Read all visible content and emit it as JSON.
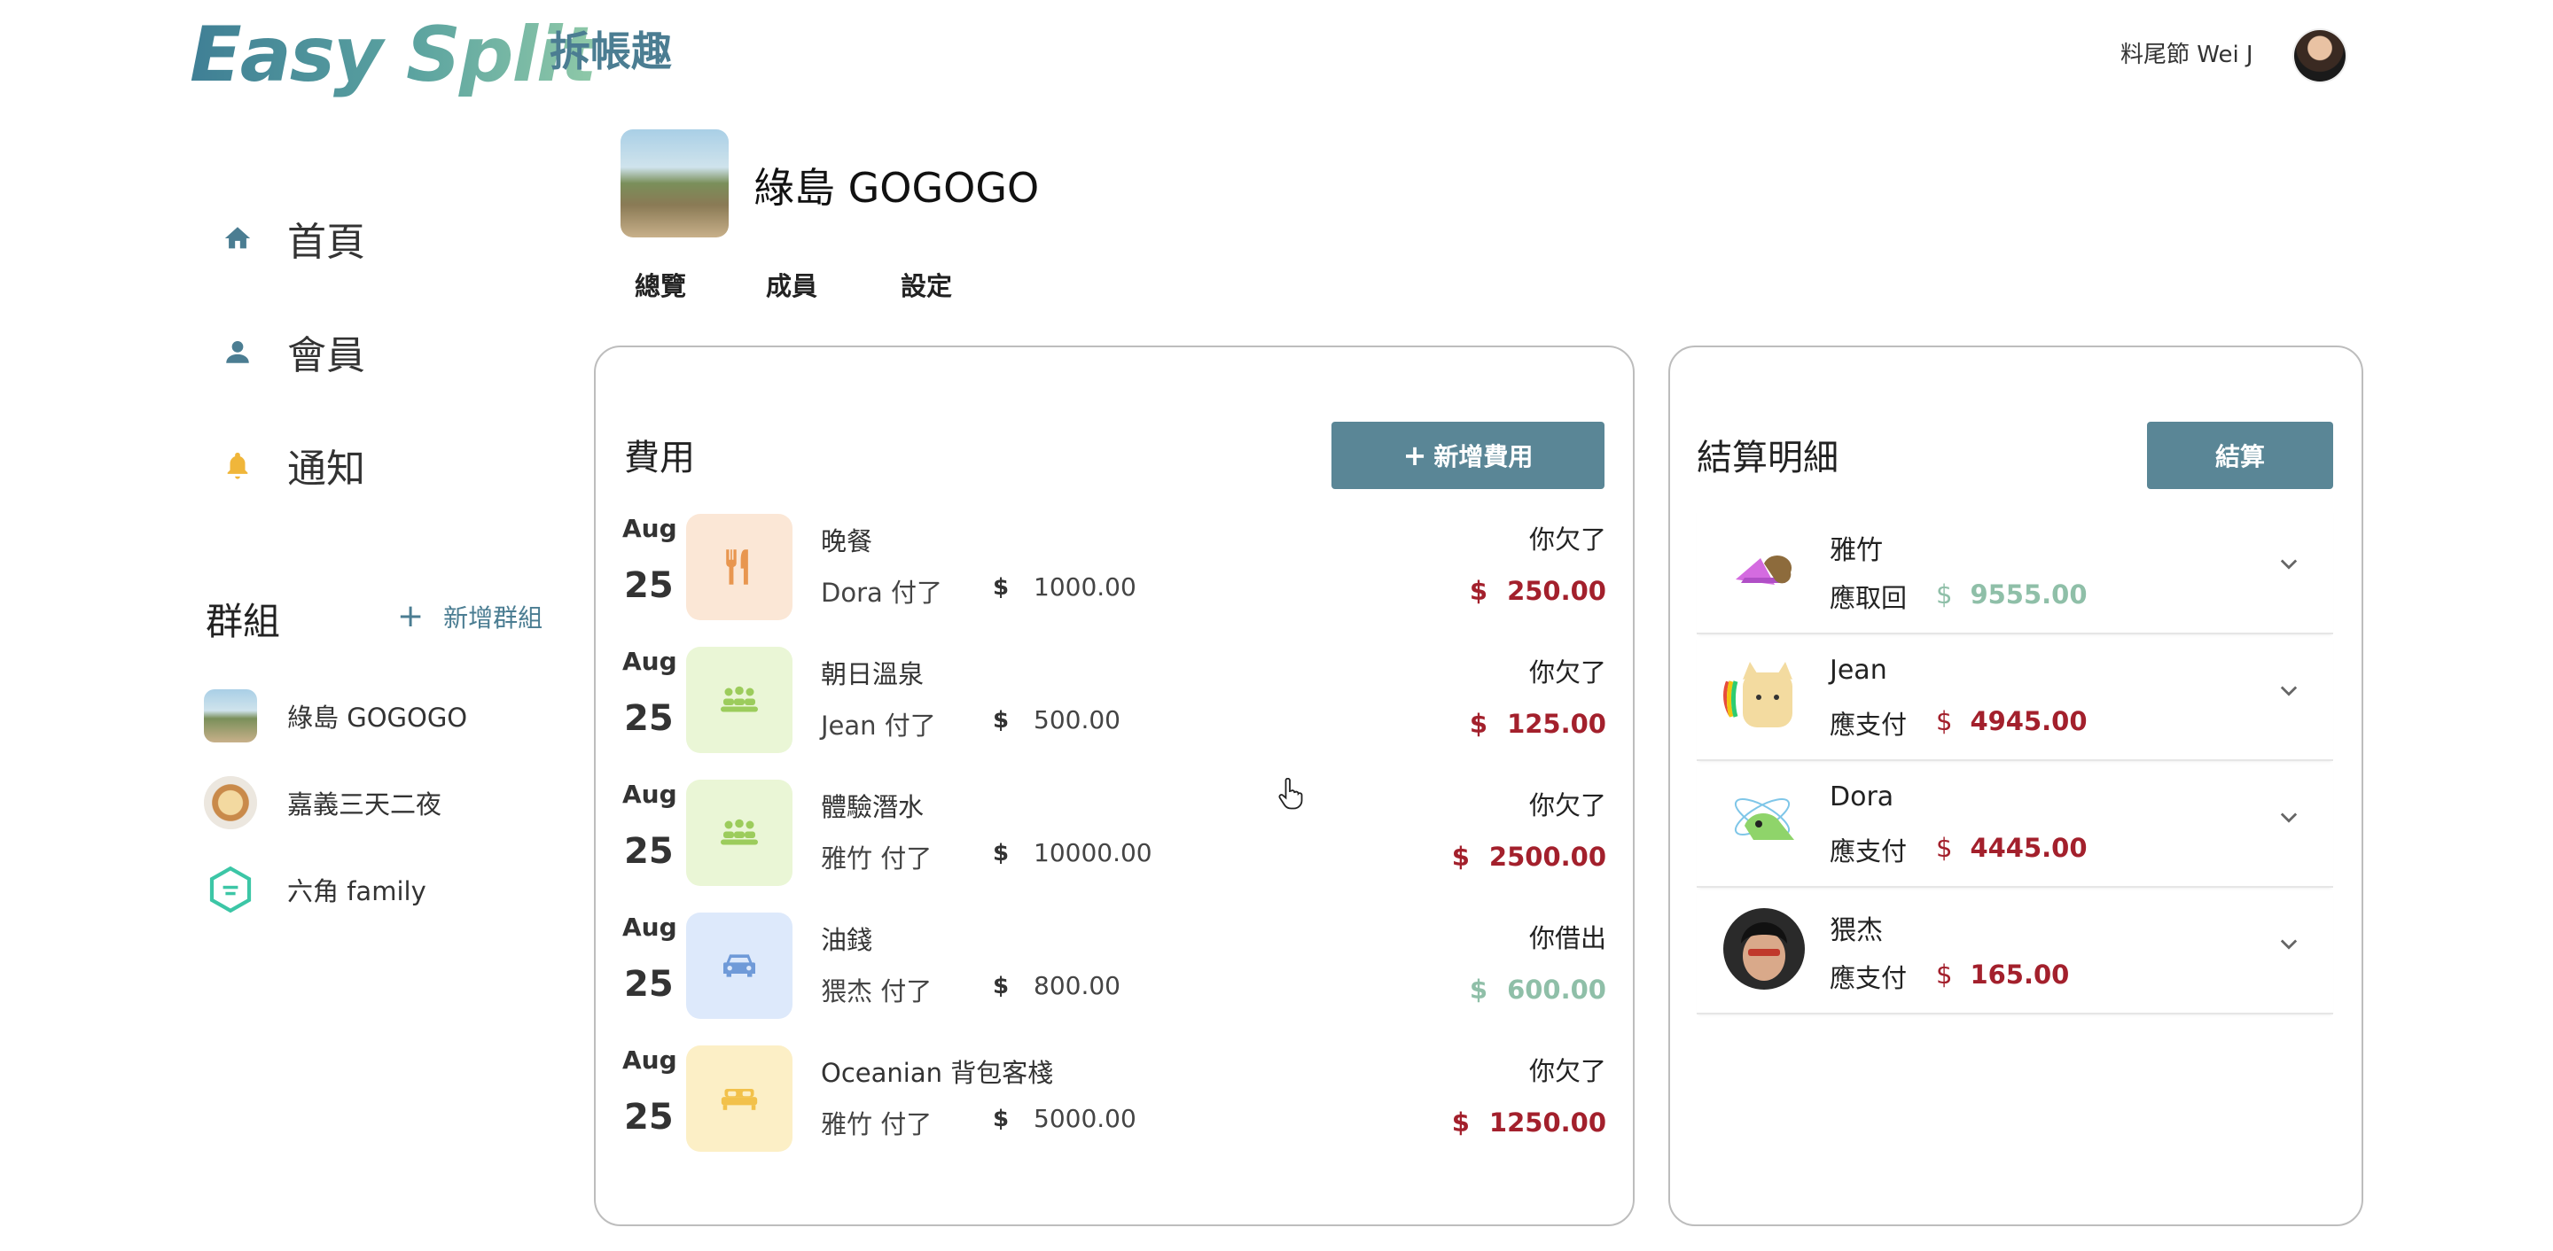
{
  "header": {
    "logo": "Easy Split",
    "logo_sub": "拆帳趣",
    "user_name": "料尾節 Wei J"
  },
  "sidebar": {
    "nav": [
      {
        "label": "首頁",
        "icon": "home-icon"
      },
      {
        "label": "會員",
        "icon": "person-icon"
      },
      {
        "label": "通知",
        "icon": "bell-icon"
      }
    ],
    "groups_title": "群組",
    "add_group": "新增群組",
    "groups": [
      {
        "name": "綠島 GOGOGO"
      },
      {
        "name": "嘉義三天二夜"
      },
      {
        "name": "六角 family"
      }
    ]
  },
  "group": {
    "title": "綠島 GOGOGO",
    "tabs": [
      "總覽",
      "成員",
      "設定"
    ]
  },
  "expenses": {
    "title": "費用",
    "add_button": "新增費用",
    "items": [
      {
        "month": "Aug",
        "day": "25",
        "name": "晚餐",
        "payer": "Dora  付了",
        "currency": "$",
        "amount": "1000.00",
        "status": "你欠了",
        "owe_currency": "$",
        "owe": "250.00",
        "icon": "utensils-icon"
      },
      {
        "month": "Aug",
        "day": "25",
        "name": "朝日溫泉",
        "payer": "Jean  付了",
        "currency": "$",
        "amount": "500.00",
        "status": "你欠了",
        "owe_currency": "$",
        "owe": "125.00",
        "icon": "people-icon"
      },
      {
        "month": "Aug",
        "day": "25",
        "name": "體驗潛水",
        "payer": "雅竹  付了",
        "currency": "$",
        "amount": "10000.00",
        "status": "你欠了",
        "owe_currency": "$",
        "owe": "2500.00",
        "icon": "people-icon"
      },
      {
        "month": "Aug",
        "day": "25",
        "name": "油錢",
        "payer": "猥杰  付了",
        "currency": "$",
        "amount": "800.00",
        "status": "你借出",
        "owe_currency": "$",
        "owe": "600.00",
        "icon": "car-icon"
      },
      {
        "month": "Aug",
        "day": "25",
        "name": "Oceanian 背包客棧",
        "payer": "雅竹  付了",
        "currency": "$",
        "amount": "5000.00",
        "status": "你欠了",
        "owe_currency": "$",
        "owe": "1250.00",
        "icon": "bed-icon"
      }
    ]
  },
  "settlement": {
    "title": "結算明細",
    "button": "結算",
    "items": [
      {
        "name": "雅竹",
        "label": "應取回",
        "currency": "$",
        "amount": "9555.00"
      },
      {
        "name": "Jean",
        "label": "應支付",
        "currency": "$",
        "amount": "4945.00"
      },
      {
        "name": "Dora",
        "label": "應支付",
        "currency": "$",
        "amount": "4445.00"
      },
      {
        "name": "猥杰",
        "label": "應支付",
        "currency": "$",
        "amount": "165.00"
      }
    ]
  },
  "colors": {
    "accent": "#5a8696",
    "owe_red": "#a3202c",
    "lent_green": "#8fbfa8"
  }
}
